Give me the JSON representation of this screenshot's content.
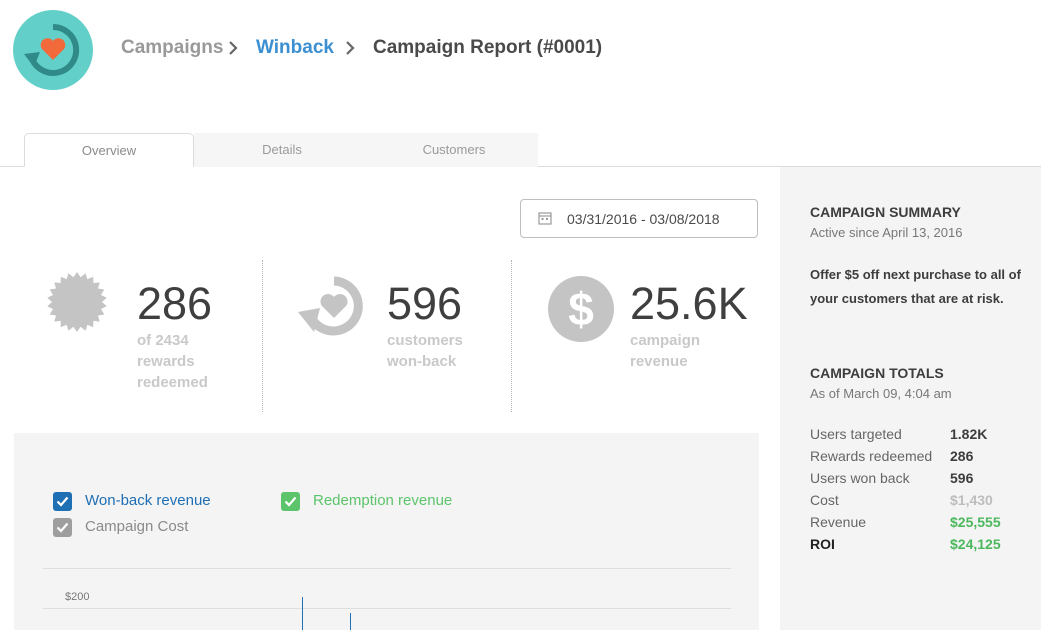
{
  "breadcrumb": {
    "items": [
      "Campaigns",
      "Winback",
      "Campaign Report (#0001)"
    ]
  },
  "tabs": [
    {
      "label": "Overview",
      "active": true
    },
    {
      "label": "Details",
      "active": false
    },
    {
      "label": "Customers",
      "active": false
    }
  ],
  "date_range": "03/31/2016 - 03/08/2018",
  "stats": [
    {
      "value": "286",
      "lines": [
        "of 2434",
        "rewards",
        "redeemed"
      ],
      "icon": "badge-icon"
    },
    {
      "value": "596",
      "lines": [
        "customers",
        "won-back"
      ],
      "icon": "heart-cycle-icon"
    },
    {
      "value": "25.6K",
      "lines": [
        "campaign",
        "revenue"
      ],
      "icon": "dollar-icon"
    }
  ],
  "chart": {
    "legend": [
      {
        "label": "Won-back revenue",
        "color": "#1f6fb5",
        "checked": true
      },
      {
        "label": "Redemption revenue",
        "color": "#5cc46a",
        "checked": true
      },
      {
        "label": "Campaign Cost",
        "color": "#9e9e9e",
        "checked": true
      }
    ],
    "y_tick": "$200"
  },
  "summary": {
    "title": "CAMPAIGN SUMMARY",
    "subtitle": "Active since April 13, 2016",
    "offer": "Offer $5 off next purchase to all of your customers that are at risk."
  },
  "totals": {
    "title": "CAMPAIGN TOTALS",
    "subtitle": "As of March 09, 4:04 am",
    "rows": [
      {
        "label": "Users targeted",
        "value": "1.82K",
        "color": "#3d3d3d"
      },
      {
        "label": "Rewards redeemed",
        "value": "286",
        "color": "#3d3d3d"
      },
      {
        "label": "Users won back",
        "value": "596",
        "color": "#3d3d3d"
      },
      {
        "label": "Cost",
        "value": "$1,430",
        "color": "#bdbdbd"
      },
      {
        "label": "Revenue",
        "value": "$25,555",
        "color": "#4cb85c"
      },
      {
        "label": "ROI",
        "value": "$24,125",
        "color": "#4cb85c"
      }
    ]
  },
  "colors": {
    "accent": "#3c8fd0",
    "logo": "#63cfc9",
    "heart": "#f26a3b"
  }
}
